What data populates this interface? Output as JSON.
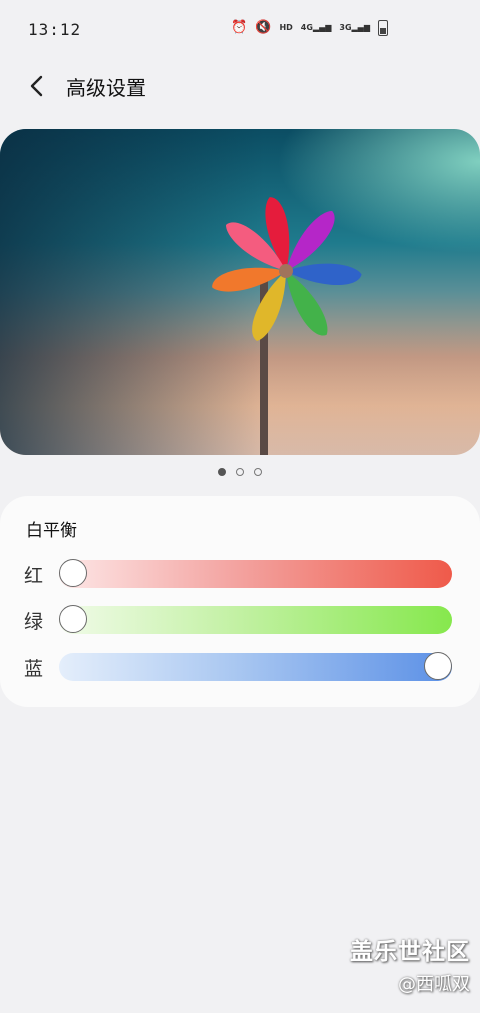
{
  "status_bar": {
    "time": "13:12",
    "icons": [
      "alarm-icon",
      "mute-icon",
      "hd-icon",
      "signal-4g-icon",
      "signal-3g-icon",
      "battery-icon"
    ],
    "hd_label": "HD",
    "net1_label": "4G",
    "net2_label": "3G"
  },
  "header": {
    "title": "高级设置"
  },
  "preview": {
    "pages": 3,
    "active_page": 1
  },
  "white_balance": {
    "title": "白平衡",
    "channels": [
      {
        "label": "红",
        "value": 0.0,
        "color": "#ef5a4a"
      },
      {
        "label": "绿",
        "value": 0.0,
        "color": "#86e84d"
      },
      {
        "label": "蓝",
        "value": 1.0,
        "color": "#5b90e6"
      }
    ]
  },
  "watermark": {
    "title": "盖乐世社区",
    "user": "@西呱双"
  }
}
